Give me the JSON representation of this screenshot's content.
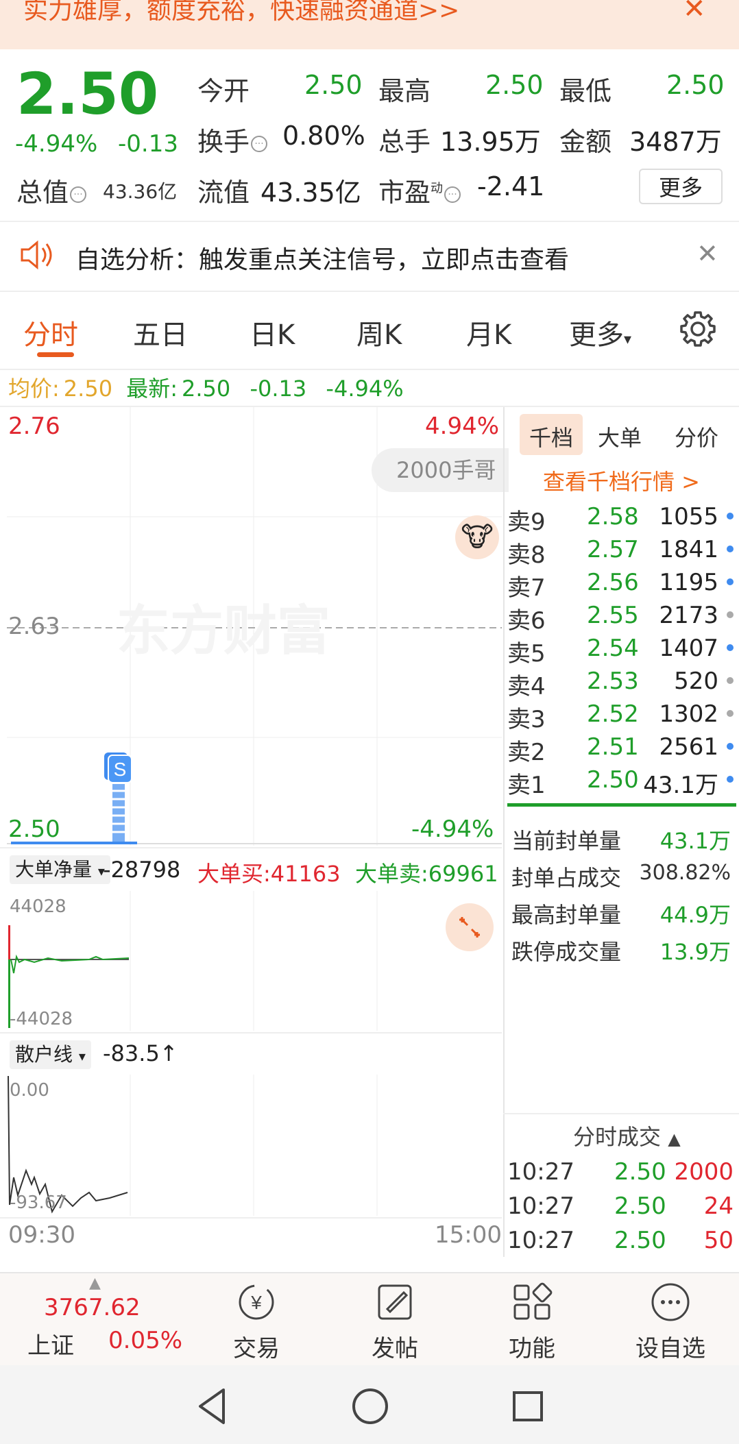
{
  "banner": {
    "text": "实力雄厚，额度充裕，快速融资通道>>",
    "close": "✕"
  },
  "quote": {
    "price": "2.50",
    "change_pct": "-4.94%",
    "change": "-0.13",
    "open_label": "今开",
    "open": "2.50",
    "high_label": "最高",
    "high": "2.50",
    "low_label": "最低",
    "low": "2.50",
    "turnover_label": "换手",
    "turnover": "0.80%",
    "volume_label": "总手",
    "volume": "13.95万",
    "amount_label": "金额",
    "amount": "3487万",
    "mktcap_label": "总值",
    "mktcap": "43.36亿",
    "float_label": "流值",
    "float": "43.35亿",
    "pe_label": "市盈",
    "pe_sup": "动",
    "pe": "-2.41",
    "more": "更多"
  },
  "notice": {
    "text": "自选分析：触发重点关注信号，立即点击查看",
    "close": "✕"
  },
  "tabs": [
    "分时",
    "五日",
    "日K",
    "周K",
    "月K",
    "更多"
  ],
  "avg_line": {
    "avg_label": "均价:",
    "avg": "2.50",
    "latest_label": "最新:",
    "latest": "2.50",
    "change": "-0.13",
    "change_pct": "-4.94%"
  },
  "main_chart": {
    "y_top": "2.76",
    "y_mid": "2.63",
    "y_bottom": "2.50",
    "pct_top": "4.94%",
    "pct_bottom": "-4.94%",
    "watermark": "东方财富",
    "bubble": "2000手哥",
    "time_start": "09:30",
    "time_end": "15:00"
  },
  "chart_data": [
    {
      "type": "line",
      "title": "",
      "xlabel": "",
      "ylabel": "",
      "x": [
        "09:30",
        "10:27"
      ],
      "series": [
        {
          "values": [
            2.5,
            2.5
          ]
        }
      ],
      "ylim": [
        2.5,
        2.76
      ]
    }
  ],
  "big_order": {
    "label": "大单净量",
    "value": "-28798",
    "buy_label": "大单买:",
    "buy": "41163",
    "sell_label": "大单卖:",
    "sell": "69961",
    "y_top": "44028",
    "y_bottom": "-44028"
  },
  "retail": {
    "label": "散户线",
    "value": "-83.5",
    "arrow": "↑",
    "y_top": "0.00",
    "y_bottom": "-93.67"
  },
  "side_tabs": [
    "千档",
    "大单",
    "分价"
  ],
  "side_link": "查看千档行情 >",
  "order_book": [
    {
      "level": "卖9",
      "price": "2.58",
      "qty": "1055",
      "dot": "blue"
    },
    {
      "level": "卖8",
      "price": "2.57",
      "qty": "1841",
      "dot": "blue"
    },
    {
      "level": "卖7",
      "price": "2.56",
      "qty": "1195",
      "dot": "blue"
    },
    {
      "level": "卖6",
      "price": "2.55",
      "qty": "2173",
      "dot": "gray"
    },
    {
      "level": "卖5",
      "price": "2.54",
      "qty": "1407",
      "dot": "blue"
    },
    {
      "level": "卖4",
      "price": "2.53",
      "qty": "520",
      "dot": "gray"
    },
    {
      "level": "卖3",
      "price": "2.52",
      "qty": "1302",
      "dot": "gray"
    },
    {
      "level": "卖2",
      "price": "2.51",
      "qty": "2561",
      "dot": "blue"
    },
    {
      "level": "卖1",
      "price": "2.50",
      "qty": "43.1万",
      "dot": "blue"
    }
  ],
  "seal": [
    {
      "label": "当前封单量",
      "value": "43.1万"
    },
    {
      "label": "封单占成交",
      "value": "308.82%"
    },
    {
      "label": "最高封单量",
      "value": "44.9万"
    },
    {
      "label": "跌停成交量",
      "value": "13.9万"
    }
  ],
  "trades_header": "分时成交",
  "trades": [
    {
      "time": "10:27",
      "price": "2.50",
      "qty": "2000"
    },
    {
      "time": "10:27",
      "price": "2.50",
      "qty": "24"
    },
    {
      "time": "10:27",
      "price": "2.50",
      "qty": "50"
    }
  ],
  "bottom_nav": {
    "index_value": "3767.62",
    "index_name": "上证",
    "index_change": "0.05%",
    "items": [
      "交易",
      "发帖",
      "功能",
      "设自选"
    ]
  },
  "colors": {
    "up": "#e0262f",
    "down": "#1f9e2a",
    "accent": "#e85a1f",
    "avg": "#e2a62c"
  }
}
